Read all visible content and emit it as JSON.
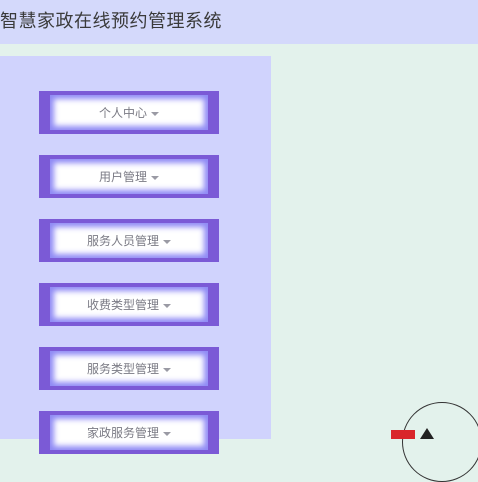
{
  "header": {
    "title": "智慧家政在线预约管理系统"
  },
  "sidebar": {
    "items": [
      {
        "label": "个人中心"
      },
      {
        "label": "用户管理"
      },
      {
        "label": "服务人员管理"
      },
      {
        "label": "收费类型管理"
      },
      {
        "label": "服务类型管理"
      },
      {
        "label": "家政服务管理"
      }
    ]
  },
  "colors": {
    "header_bg": "#d4d9fb",
    "sidebar_bg": "#d0d3fd",
    "content_bg": "#e3f2ec",
    "menu_border": "#7b5ad6",
    "menu_glow": "#8f8af5",
    "menu_text": "#7a7a84"
  },
  "icons": {
    "menu_caret": "caret-down-icon",
    "corner_logo": "logo"
  }
}
